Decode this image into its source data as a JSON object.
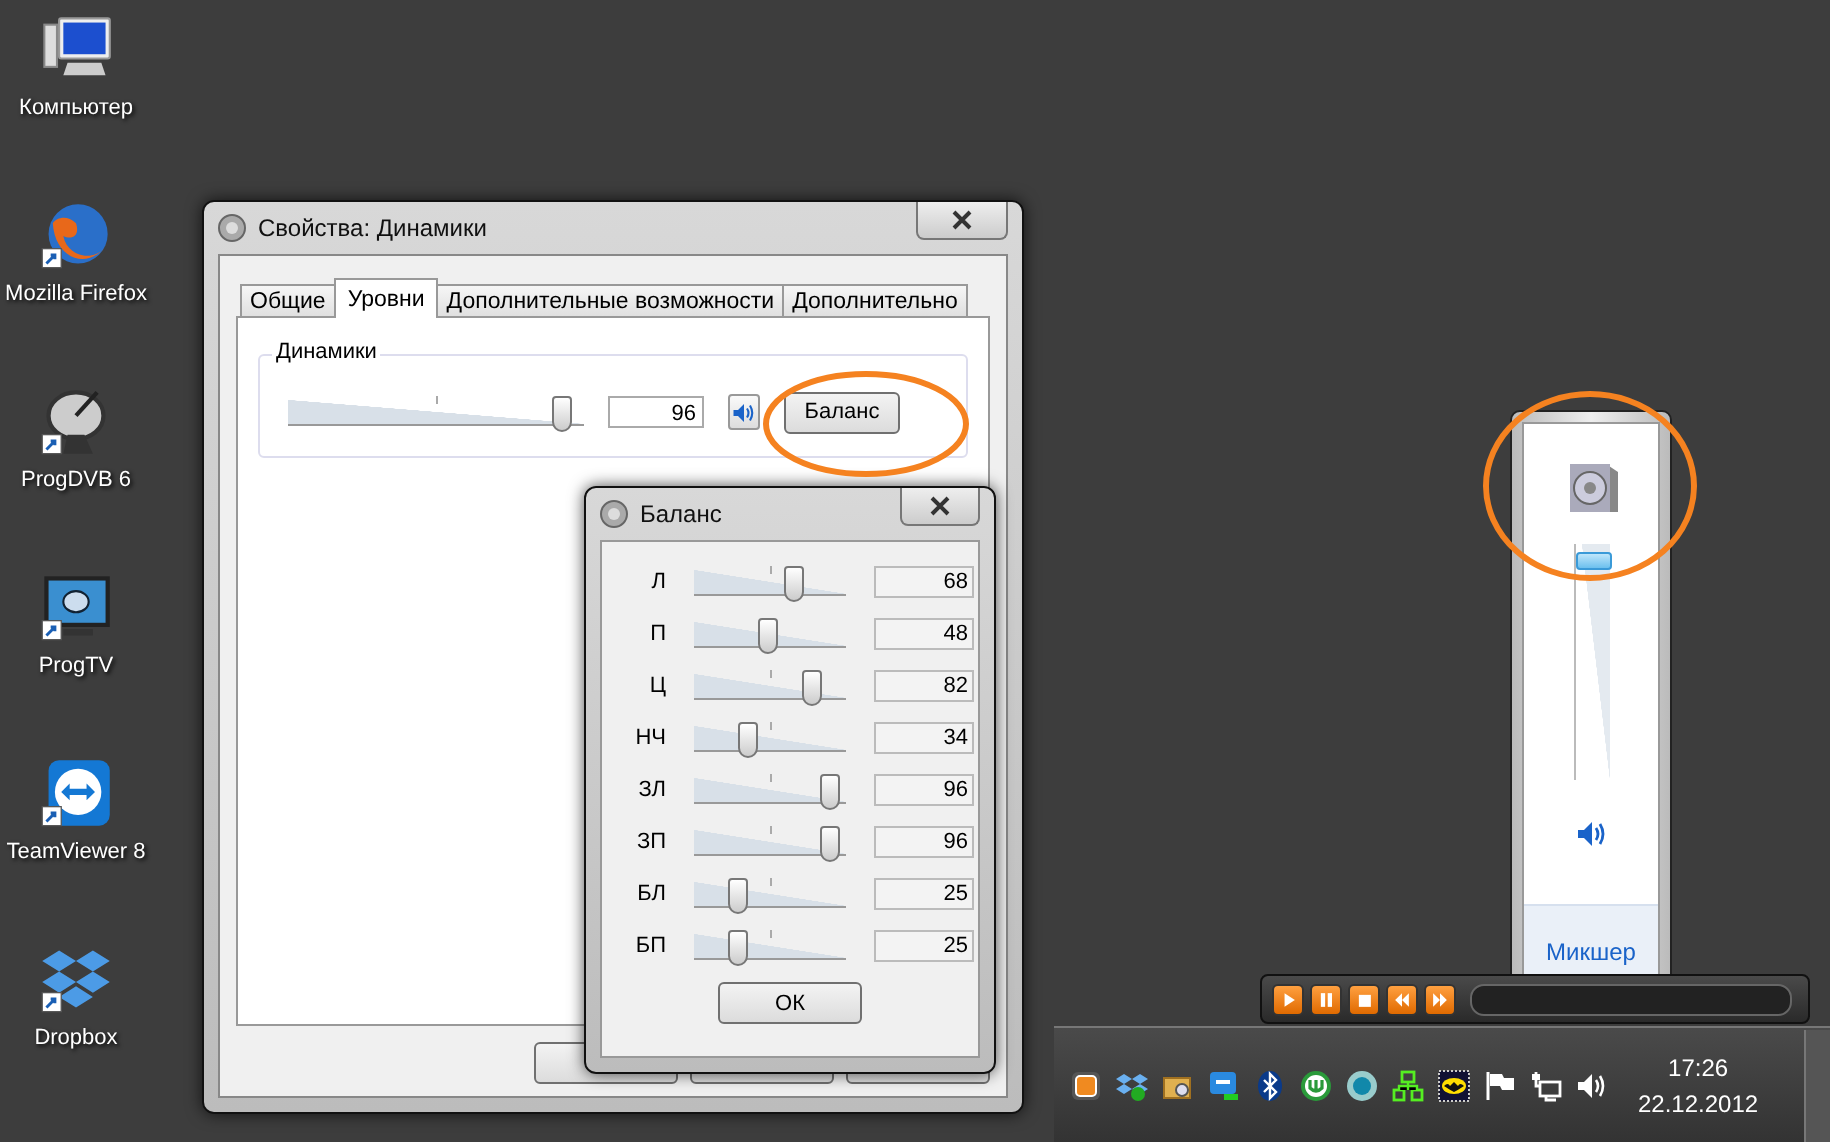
{
  "desktop_icons": [
    {
      "label": "Компьютер",
      "kind": "computer"
    },
    {
      "label": "Mozilla Firefox",
      "kind": "browser"
    },
    {
      "label": "ProgDVB 6",
      "kind": "dish"
    },
    {
      "label": "ProgTV",
      "kind": "tv"
    },
    {
      "label": "TeamViewer 8",
      "kind": "remote"
    },
    {
      "label": "Dropbox",
      "kind": "box"
    }
  ],
  "properties_window": {
    "title": "Свойства: Динамики",
    "tabs": [
      {
        "label": "Общие",
        "selected": false
      },
      {
        "label": "Уровни",
        "selected": true
      },
      {
        "label": "Дополнительные возможности",
        "selected": false
      },
      {
        "label": "Дополнительно",
        "selected": false
      }
    ],
    "group_label": "Динамики",
    "level": 0.96,
    "value": "96",
    "balance_button": "Баланс"
  },
  "balance_window": {
    "title": "Баланс",
    "channels": [
      {
        "name": "Л",
        "level": 0.68,
        "reading": "68"
      },
      {
        "name": "П",
        "level": 0.48,
        "reading": "48"
      },
      {
        "name": "Ц",
        "level": 0.82,
        "reading": "82"
      },
      {
        "name": "НЧ",
        "level": 0.34,
        "reading": "34"
      },
      {
        "name": "ЗЛ",
        "level": 0.96,
        "reading": "96"
      },
      {
        "name": "ЗП",
        "level": 0.96,
        "reading": "96"
      },
      {
        "name": "БЛ",
        "level": 0.25,
        "reading": "25"
      },
      {
        "name": "БП",
        "level": 0.25,
        "reading": "25"
      }
    ],
    "ok_button": "ОК"
  },
  "volume_mixer": {
    "level": 0.96,
    "mixer_link": "Микшер"
  },
  "taskbar": {
    "time": "17:26",
    "date": "22.12.2012"
  }
}
